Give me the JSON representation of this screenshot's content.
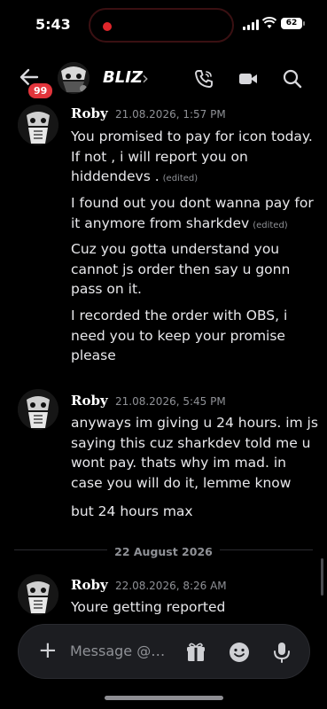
{
  "status_bar": {
    "time": "5:43",
    "battery": "62"
  },
  "header": {
    "title": "BLIZ",
    "unread_badge": "99",
    "icons": [
      "phone-icon",
      "video-icon",
      "search-icon"
    ]
  },
  "messages": [
    {
      "author": "Roby",
      "timestamp": "21.08.2026, 1:57 PM",
      "lines": [
        {
          "text": "You promised to pay for icon today. If not , i will report you on hiddendevs  .",
          "edited": "(edited)"
        },
        {
          "text": "I found out you dont wanna pay for it anymore from sharkdev",
          "edited": "(edited)"
        },
        {
          "text": "Cuz you gotta understand you cannot js order then say u gonn pass on it.",
          "edited": ""
        },
        {
          "text": "I recorded the order with OBS, i need  you to keep your promise please",
          "edited": ""
        }
      ]
    },
    {
      "author": "Roby",
      "timestamp": "21.08.2026, 5:45 PM",
      "lines": [
        {
          "text": "anyways im giving u 24 hours. im js saying this cuz sharkdev told me u wont pay. thats why im mad. in case you will do it, lemme know",
          "edited": ""
        },
        {
          "text": "but 24 hours max",
          "edited": ""
        }
      ]
    },
    {
      "author": "Roby",
      "timestamp": "22.08.2026, 8:26 AM",
      "lines": [
        {
          "text": "Youre getting reported",
          "edited": ""
        }
      ]
    }
  ],
  "date_divider": "22 August 2026",
  "composer": {
    "placeholder": "Message @…",
    "icons": [
      "plus-icon",
      "gift-icon",
      "emoji-icon",
      "mic-icon"
    ]
  },
  "colors": {
    "background": "#000000",
    "badge": "#e2343b",
    "muted": "#8f9196"
  }
}
